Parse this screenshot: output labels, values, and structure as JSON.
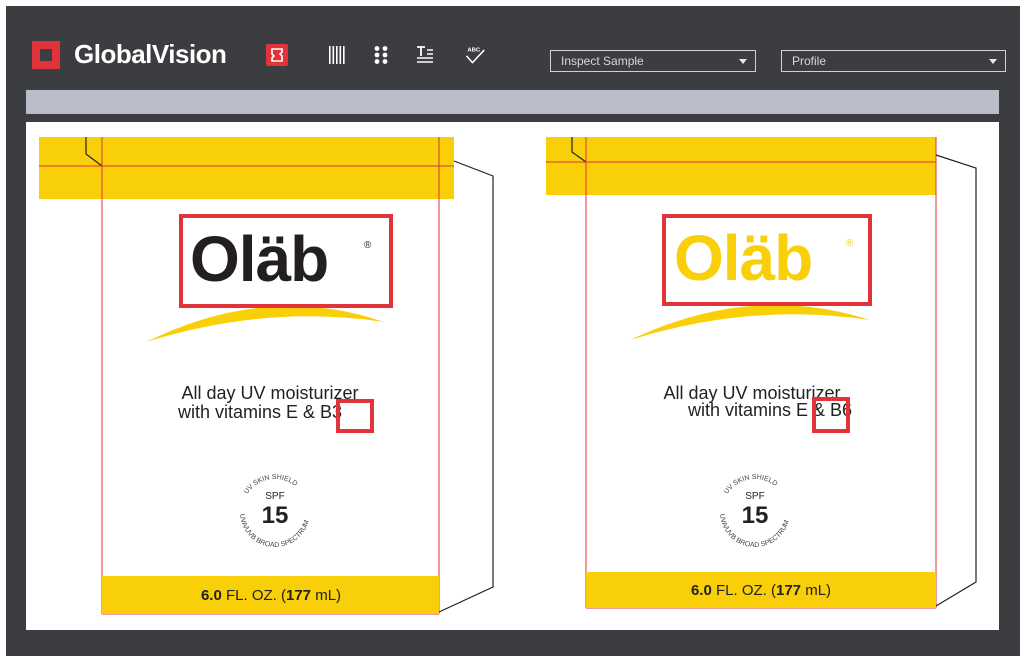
{
  "app": {
    "name": "GlobalVision"
  },
  "toolbar": {
    "tools": [
      "graphics-compare-icon",
      "barcode-icon",
      "braille-icon",
      "text-compare-icon",
      "spell-check-icon"
    ],
    "inspect_dropdown": "Inspect Sample",
    "profile_dropdown": "Profile"
  },
  "colors": {
    "accent": "#e0333a",
    "brand_yellow": "#f8cf08",
    "toolbar_bg": "#3c3d40",
    "strip": "#b9bdc8"
  },
  "panels": [
    {
      "brand": "Oläb",
      "registered": "®",
      "tagline_line1": "All day UV moisturizer",
      "tagline_line2_prefix": "with vitamins E & ",
      "tagline_highlight": "B3",
      "spf_ring_top": "UV SKIN SHIELD",
      "spf_ring_bottom": "UVA/UVB BROAD SPECTRUM",
      "spf_label": "SPF",
      "spf_value": "15",
      "volume_bold": "6.0",
      "volume_mid": " FL. OZ. (",
      "volume_bold2": "177",
      "volume_end": " mL)"
    },
    {
      "brand": "Oläb",
      "registered": "®",
      "tagline_line1": "All day UV moisturizer",
      "tagline_line2_prefix": "with vitamins E & ",
      "tagline_highlight": "B6",
      "spf_ring_top": "UV SKIN SHIELD",
      "spf_ring_bottom": "UVA/UVB BROAD SPECTRUM",
      "spf_label": "SPF",
      "spf_value": "15",
      "volume_bold": "6.0",
      "volume_mid": " FL. OZ. (",
      "volume_bold2": "177",
      "volume_end": " mL)"
    }
  ]
}
